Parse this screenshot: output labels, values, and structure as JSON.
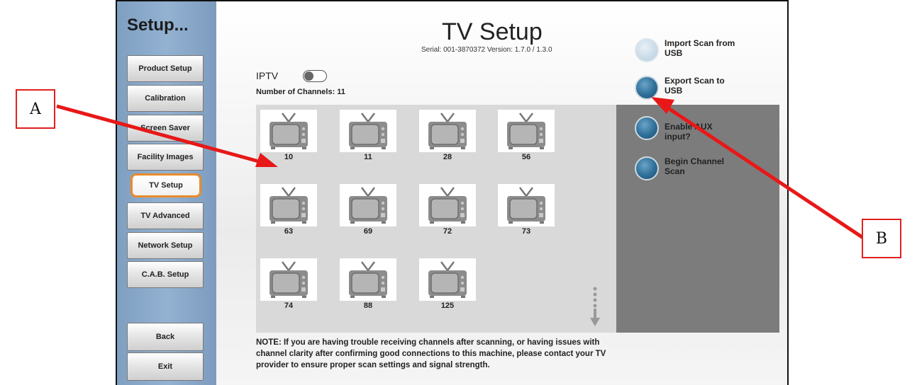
{
  "sidebar": {
    "title": "Setup...",
    "items": [
      {
        "label": "Product Setup"
      },
      {
        "label": "Calibration"
      },
      {
        "label": "Screen Saver"
      },
      {
        "label": "Facility Images"
      },
      {
        "label": "TV Setup",
        "active": true
      },
      {
        "label": "TV Advanced"
      },
      {
        "label": "Network Setup"
      },
      {
        "label": "C.A.B. Setup"
      }
    ],
    "back_label": "Back",
    "exit_label": "Exit"
  },
  "header": {
    "title": "TV Setup",
    "serial": "Serial: 001-3870372  Version: 1.7.0 / 1.3.0"
  },
  "iptv": {
    "label": "IPTV",
    "enabled": false,
    "channel_count": "Number of Channels: 11"
  },
  "channels": [
    "10",
    "11",
    "28",
    "56",
    "63",
    "69",
    "72",
    "73",
    "74",
    "88",
    "125"
  ],
  "actions": [
    {
      "label": "Import Scan from USB",
      "state": "disabled",
      "icon": "round-button-icon"
    },
    {
      "label": "Export Scan to USB",
      "state": "enabled",
      "icon": "round-button-icon"
    },
    {
      "label": "Enable AUX input?",
      "state": "enabled",
      "icon": "round-button-icon"
    },
    {
      "label": "Begin Channel Scan",
      "state": "enabled",
      "icon": "round-button-icon"
    }
  ],
  "note": "NOTE: If you are having trouble receiving channels after scanning, or having issues with channel clarity after confirming good connections to this machine, please contact your TV provider to ensure proper scan settings and signal strength.",
  "callouts": {
    "a": "A",
    "b": "B"
  },
  "colors": {
    "sidebar": "#8aa9ca",
    "active_outline": "#ea8b2b",
    "callout_red": "#e02020",
    "panel_gray": "#7c7c7c",
    "grid_bg": "#d9d9d9"
  }
}
